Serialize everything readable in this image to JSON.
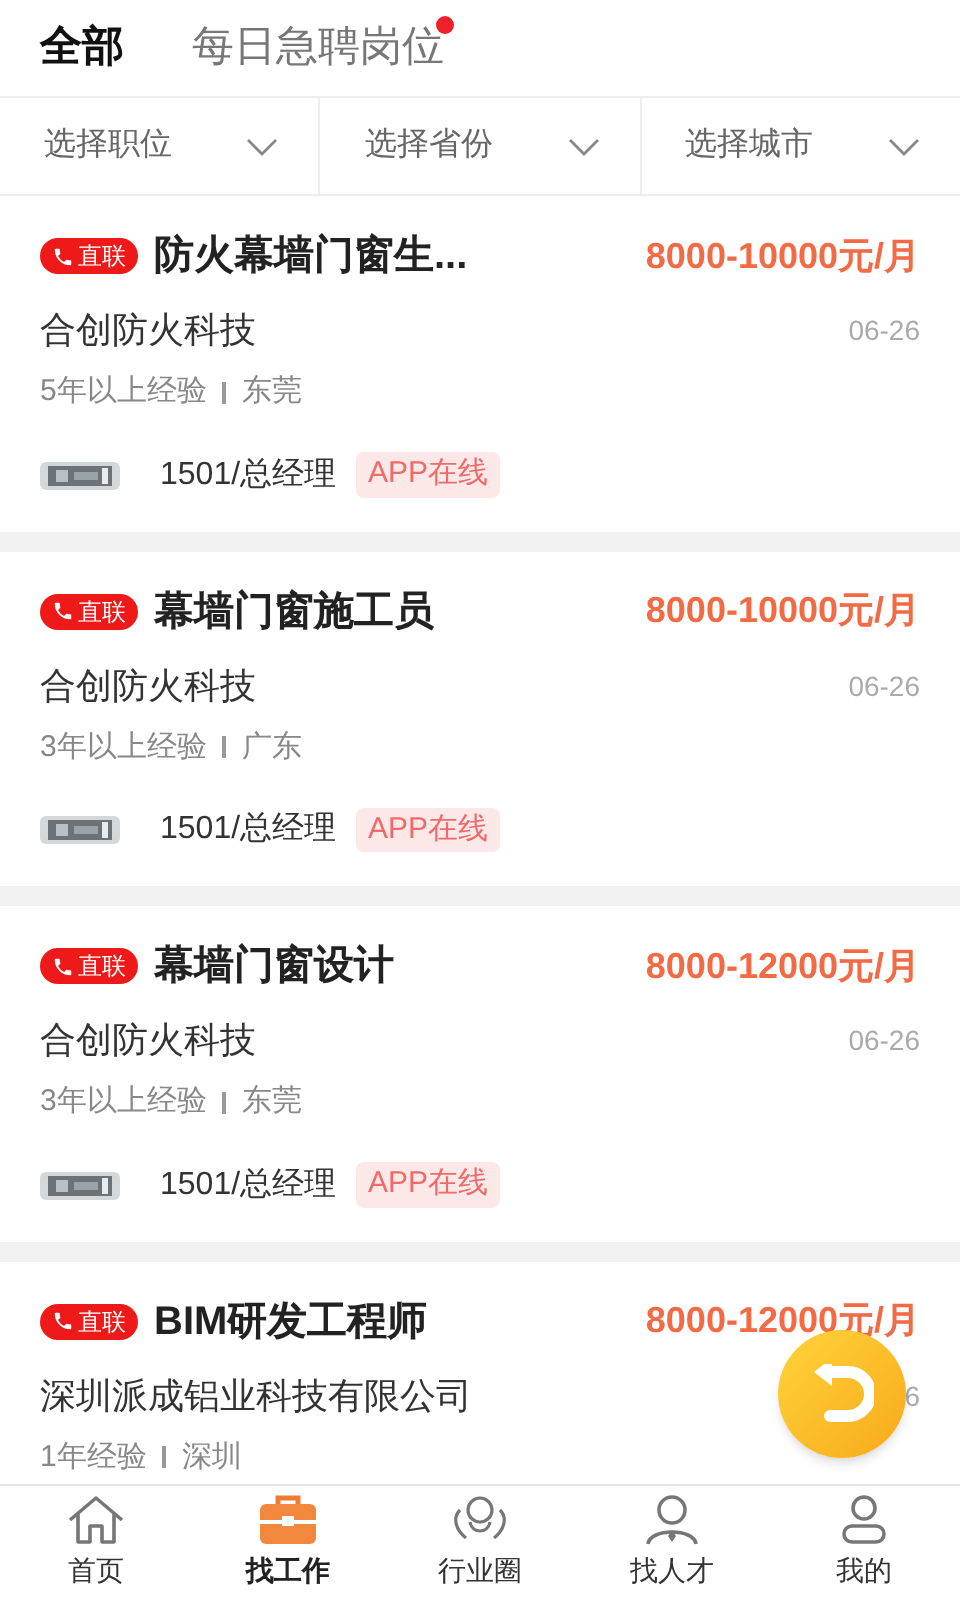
{
  "tabs": [
    {
      "label": "全部",
      "selected": true,
      "dot": false
    },
    {
      "label": "每日急聘岗位",
      "selected": false,
      "dot": true
    }
  ],
  "filters": [
    {
      "label": "选择职位"
    },
    {
      "label": "选择省份"
    },
    {
      "label": "选择城市"
    }
  ],
  "jobs": [
    {
      "badge": "直联",
      "title": "防火幕墙门窗生...",
      "salary": "8000-10000元/月",
      "company": "合创防火科技",
      "date": "06-26",
      "experience": "5年以上经验",
      "location": "东莞",
      "contact": "1501/总经理",
      "status": "APP在线"
    },
    {
      "badge": "直联",
      "title": "幕墙门窗施工员",
      "salary": "8000-10000元/月",
      "company": "合创防火科技",
      "date": "06-26",
      "experience": "3年以上经验",
      "location": "广东",
      "contact": "1501/总经理",
      "status": "APP在线"
    },
    {
      "badge": "直联",
      "title": "幕墙门窗设计",
      "salary": "8000-12000元/月",
      "company": "合创防火科技",
      "date": "06-26",
      "experience": "3年以上经验",
      "location": "东莞",
      "contact": "1501/总经理",
      "status": "APP在线"
    },
    {
      "badge": "直联",
      "title": "BIM研发工程师",
      "salary": "8000-12000元/月",
      "company": "深圳派成铝业科技有限公司",
      "date": "6",
      "experience": "1年经验",
      "location": "深圳"
    }
  ],
  "nav": [
    {
      "label": "首页",
      "selected": false
    },
    {
      "label": "找工作",
      "selected": true
    },
    {
      "label": "行业圈",
      "selected": false
    },
    {
      "label": "找人才",
      "selected": false
    },
    {
      "label": "我的",
      "selected": false
    }
  ]
}
